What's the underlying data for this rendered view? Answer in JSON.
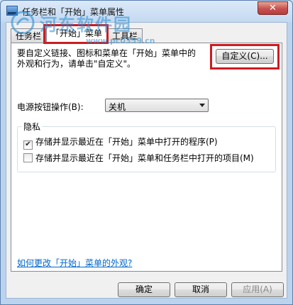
{
  "window": {
    "title": "任务栏和「开始」菜单属性",
    "close_glyph": "✕"
  },
  "tabs": [
    {
      "label": "任务栏",
      "active": false
    },
    {
      "label": "「开始」菜单",
      "active": true
    },
    {
      "label": "工具栏",
      "active": false
    }
  ],
  "start_menu": {
    "description_line1": "要自定义链接、图标和菜单在「开始」菜单中的",
    "description_line2": "外观和行为，请单击\"自定义\"。",
    "customize_button": "自定义(C)...",
    "power_label": "电源按钮操作(B):",
    "power_value": "关机",
    "privacy": {
      "title": "隐私",
      "items": [
        {
          "label": "存储并显示最近在「开始」菜单中打开的程序(P)",
          "checked": true
        },
        {
          "label": "存储并显示最近在「开始」菜单和任务栏中打开的项目(M)",
          "checked": false
        }
      ]
    },
    "help_link": "如何更改「开始」菜单的外观?"
  },
  "footer": {
    "ok": "确定",
    "cancel": "取消",
    "apply": "应用(A)"
  },
  "watermark": {
    "text": "河东软件园",
    "url": "www.pc0359.cn"
  },
  "colors": {
    "highlight_box": "#cc1c22",
    "link": "#0066cc",
    "title_gradient_top": "#dbe9f8"
  }
}
